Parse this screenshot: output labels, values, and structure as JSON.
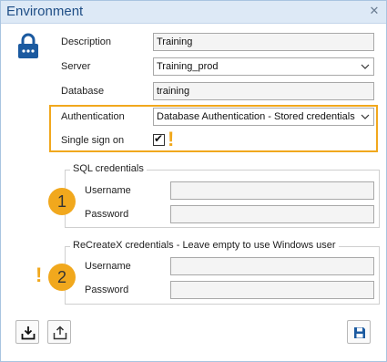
{
  "window": {
    "title": "Environment",
    "close_glyph": "✕"
  },
  "icons": {
    "lock": "lock-icon",
    "close": "close-icon",
    "import": "import-icon",
    "export": "export-icon",
    "save": "save-icon",
    "accent": "#1b5aa0",
    "highlight": "#f1a81d"
  },
  "form": {
    "description": {
      "label": "Description",
      "value": "Training"
    },
    "server": {
      "label": "Server",
      "value": "Training_prod"
    },
    "database": {
      "label": "Database",
      "value": "training"
    },
    "authentication": {
      "label": "Authentication",
      "value": "Database Authentication - Stored credentials"
    },
    "sso": {
      "label": "Single sign on",
      "checked": true,
      "check_glyph": "✔"
    }
  },
  "sql_credentials": {
    "legend": "SQL credentials",
    "badge": "1",
    "username_label": "Username",
    "password_label": "Password",
    "username_value": "",
    "password_value": ""
  },
  "recreatex_credentials": {
    "legend": "ReCreateX credentials - Leave empty to use Windows user",
    "badge": "2",
    "username_label": "Username",
    "password_label": "Password",
    "username_value": "",
    "password_value": ""
  },
  "markers": {
    "excl": "!"
  }
}
